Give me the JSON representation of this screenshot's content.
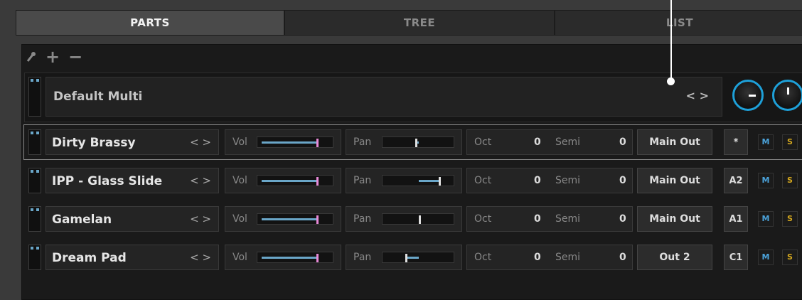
{
  "tabs": [
    {
      "label": "PARTS",
      "active": true
    },
    {
      "label": "TREE",
      "active": false
    },
    {
      "label": "LIST",
      "active": false
    }
  ],
  "toolbar": {
    "icons": [
      "wrench-icon",
      "plus-icon",
      "minus-icon"
    ]
  },
  "multi": {
    "name": "Default Multi",
    "nav": "< >"
  },
  "parts": [
    {
      "name": "Dirty Brassy",
      "nav": "< >",
      "vol_label": "Vol",
      "vol": 0.82,
      "pan_label": "Pan",
      "pan": 0.45,
      "oct_label": "Oct",
      "oct": "0",
      "semi_label": "Semi",
      "semi": "0",
      "output": "Main Out",
      "key": "*",
      "m": "M",
      "s": "S",
      "selected": true
    },
    {
      "name": "IPP - Glass Slide",
      "nav": "< >",
      "vol_label": "Vol",
      "vol": 0.82,
      "pan_label": "Pan",
      "pan": 0.8,
      "oct_label": "Oct",
      "oct": "0",
      "semi_label": "Semi",
      "semi": "0",
      "output": "Main Out",
      "key": "A2",
      "m": "M",
      "s": "S",
      "selected": false
    },
    {
      "name": "Gamelan",
      "nav": "< >",
      "vol_label": "Vol",
      "vol": 0.82,
      "pan_label": "Pan",
      "pan": 0.5,
      "oct_label": "Oct",
      "oct": "0",
      "semi_label": "Semi",
      "semi": "0",
      "output": "Main Out",
      "key": "A1",
      "m": "M",
      "s": "S",
      "selected": false
    },
    {
      "name": "Dream Pad",
      "nav": "< >",
      "vol_label": "Vol",
      "vol": 0.82,
      "pan_label": "Pan",
      "pan": 0.3,
      "oct_label": "Oct",
      "oct": "0",
      "semi_label": "Semi",
      "semi": "0",
      "output": "Out 2",
      "key": "C1",
      "m": "M",
      "s": "S",
      "selected": false
    }
  ],
  "colors": {
    "accent": "#1ea0d8",
    "volume_thumb": "#e88ad8",
    "solo": "#d3a71e"
  }
}
